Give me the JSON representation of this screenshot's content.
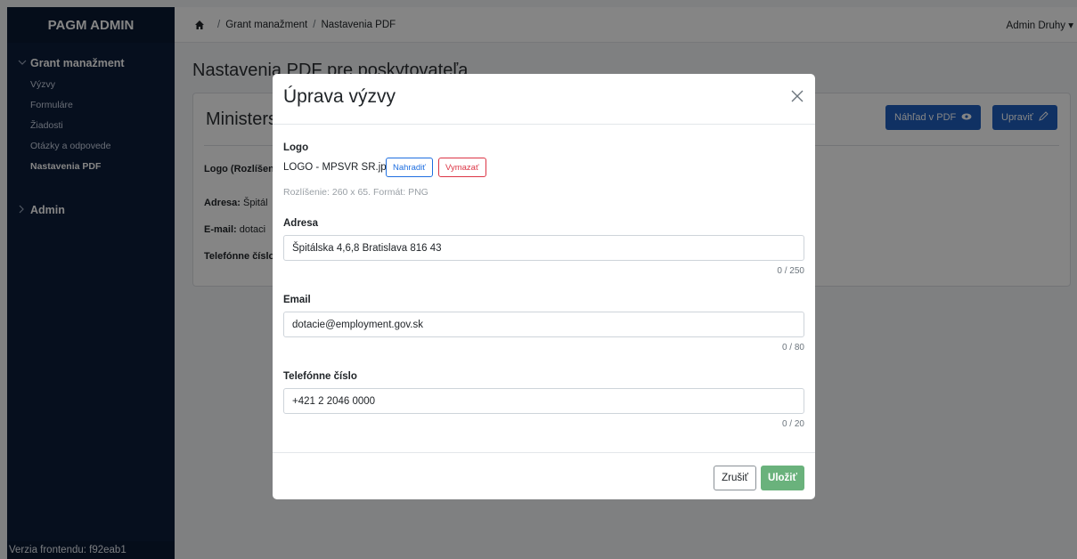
{
  "sidebar": {
    "brand": "PAGM ADMIN",
    "groups": [
      {
        "label": "Grant manažment",
        "expanded": true,
        "items": [
          {
            "label": "Výzvy"
          },
          {
            "label": "Formuláre"
          },
          {
            "label": "Žiadosti"
          },
          {
            "label": "Otázky a odpovede"
          },
          {
            "label": "Nastavenia PDF",
            "active": true
          }
        ]
      },
      {
        "label": "Admin",
        "expanded": false
      }
    ],
    "footer": "Verzia frontendu: f92eab1"
  },
  "topbar": {
    "breadcrumb": [
      "Grant manažment",
      "Nastavenia PDF"
    ],
    "separator": "/",
    "user": "Admin Druhy",
    "caret": "▾"
  },
  "page": {
    "title": "Nastavenia PDF pre poskytovateľa",
    "card": {
      "title": "Ministers",
      "preview_button": "Náhľad v PDF",
      "edit_button": "Upraviť",
      "rows": [
        {
          "label": "Logo (Rozlíšen",
          "value": ""
        },
        {
          "label": "Adresa:",
          "value": "Špitál"
        },
        {
          "label": "E-mail:",
          "value": "dotaci"
        },
        {
          "label": "Telefónne číslo",
          "value": ""
        }
      ]
    }
  },
  "modal": {
    "title": "Úprava výzvy",
    "close_symbol": "×",
    "logo": {
      "label": "Logo",
      "file": "LOGO - MPSVR SR.jpg",
      "replace_button": "Nahradiť",
      "delete_button": "Vymazať",
      "hint": "Rozlíšenie: 260 x 65. Formát: PNG"
    },
    "address": {
      "label": "Adresa",
      "value": "Špitálska 4,6,8 Bratislava 816 43",
      "counter": "0 / 250"
    },
    "email": {
      "label": "Email",
      "value": "dotacie@employment.gov.sk",
      "counter": "0 / 80"
    },
    "phone": {
      "label": "Telefónne číslo",
      "value": "+421 2 2046 0000",
      "counter": "0 / 20"
    },
    "cancel_button": "Zrušiť",
    "save_button": "Uložiť"
  },
  "colors": {
    "sidebar_bg": "#0d1e3a",
    "primary": "#1f5fbf",
    "save": "#6ab27c",
    "danger": "#dc3545"
  }
}
